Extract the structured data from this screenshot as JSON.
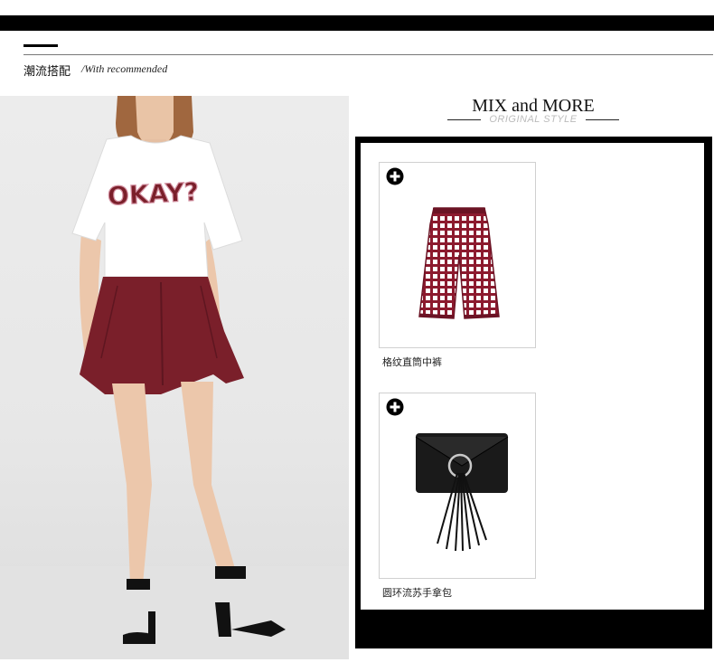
{
  "header": {
    "title_cn": "潮流搭配",
    "title_en": "/With recommended"
  },
  "mix": {
    "title": "MIX and MORE",
    "subtitle": "ORIGINAL STYLE"
  },
  "model_image": {
    "shirt_text": "OKAY?"
  },
  "products": [
    {
      "name": "格纹直筒中裤",
      "icon": "plus-circle-icon",
      "image": "plaid-shorts"
    },
    {
      "name": "圆环流苏手拿包",
      "icon": "plus-circle-icon",
      "image": "black-tassel-clutch"
    }
  ],
  "colors": {
    "frame": "#000000",
    "shorts": "#7a1f2a",
    "plaid": "#8c1a2e"
  }
}
